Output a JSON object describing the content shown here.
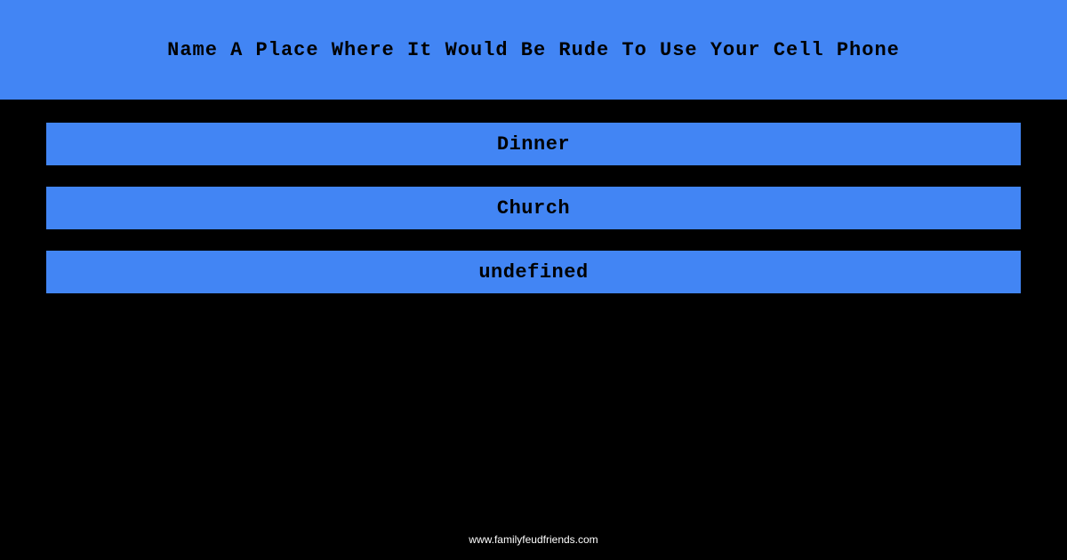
{
  "header": {
    "title": "Name A Place Where It Would Be Rude To Use Your Cell Phone"
  },
  "answers": [
    {
      "label": "Dinner"
    },
    {
      "label": "Church"
    },
    {
      "label": "undefined"
    }
  ],
  "footer": {
    "url": "www.familyfeudfriends.com"
  },
  "colors": {
    "accent": "#4285f4",
    "background": "#000000"
  }
}
